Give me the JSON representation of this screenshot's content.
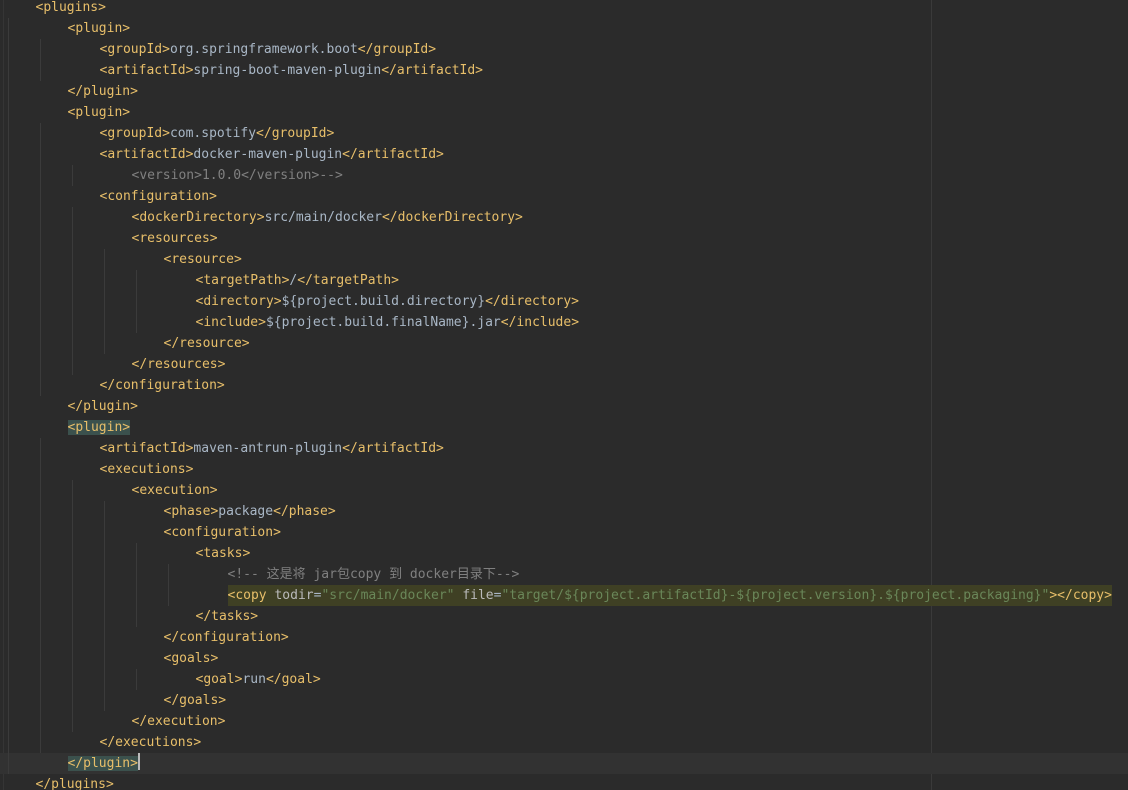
{
  "editor": {
    "file_language": "xml",
    "colors": {
      "background": "#2b2b2b",
      "tag": "#e8bf6a",
      "text": "#a9b7c6",
      "attribute": "#bababa",
      "value": "#6a8759",
      "comment": "#808080",
      "matched_tag_highlight": "#3b514d",
      "selection_highlight": "#3f4024",
      "caret_line": "#323232"
    },
    "lines": [
      {
        "indent": 1,
        "tokens": [
          {
            "k": "tag",
            "t": "<plugins>"
          }
        ]
      },
      {
        "indent": 2,
        "tokens": [
          {
            "k": "tag",
            "t": "<plugin>"
          }
        ]
      },
      {
        "indent": 3,
        "tokens": [
          {
            "k": "tag",
            "t": "<groupId>"
          },
          {
            "k": "text",
            "t": "org.springframework.boot"
          },
          {
            "k": "tag",
            "t": "</groupId>"
          }
        ]
      },
      {
        "indent": 3,
        "tokens": [
          {
            "k": "tag",
            "t": "<artifactId>"
          },
          {
            "k": "text",
            "t": "spring-boot-maven-plugin"
          },
          {
            "k": "tag",
            "t": "</artifactId>"
          }
        ]
      },
      {
        "indent": 2,
        "tokens": [
          {
            "k": "tag",
            "t": "</plugin>"
          }
        ]
      },
      {
        "indent": 2,
        "tokens": [
          {
            "k": "tag",
            "t": "<plugin>"
          }
        ]
      },
      {
        "indent": 3,
        "tokens": [
          {
            "k": "tag",
            "t": "<groupId>"
          },
          {
            "k": "text",
            "t": "com.spotify"
          },
          {
            "k": "tag",
            "t": "</groupId>"
          }
        ]
      },
      {
        "indent": 3,
        "tokens": [
          {
            "k": "tag",
            "t": "<artifactId>"
          },
          {
            "k": "text",
            "t": "docker-maven-plugin"
          },
          {
            "k": "tag",
            "t": "</artifactId>"
          }
        ]
      },
      {
        "indent": 4,
        "tokens": [
          {
            "k": "com",
            "t": "<version>1.0.0</version>-->"
          }
        ]
      },
      {
        "indent": 3,
        "tokens": [
          {
            "k": "tag",
            "t": "<configuration>"
          }
        ]
      },
      {
        "indent": 4,
        "tokens": [
          {
            "k": "tag",
            "t": "<dockerDirectory>"
          },
          {
            "k": "text",
            "t": "src/main/docker"
          },
          {
            "k": "tag",
            "t": "</dockerDirectory>"
          }
        ]
      },
      {
        "indent": 4,
        "tokens": [
          {
            "k": "tag",
            "t": "<resources>"
          }
        ]
      },
      {
        "indent": 5,
        "tokens": [
          {
            "k": "tag",
            "t": "<resource>"
          }
        ]
      },
      {
        "indent": 6,
        "tokens": [
          {
            "k": "tag",
            "t": "<targetPath>"
          },
          {
            "k": "text",
            "t": "/"
          },
          {
            "k": "tag",
            "t": "</targetPath>"
          }
        ]
      },
      {
        "indent": 6,
        "tokens": [
          {
            "k": "tag",
            "t": "<directory>"
          },
          {
            "k": "text",
            "t": "${project.build.directory}"
          },
          {
            "k": "tag",
            "t": "</directory>"
          }
        ]
      },
      {
        "indent": 6,
        "tokens": [
          {
            "k": "tag",
            "t": "<include>"
          },
          {
            "k": "text",
            "t": "${project.build.finalName}.jar"
          },
          {
            "k": "tag",
            "t": "</include>"
          }
        ]
      },
      {
        "indent": 5,
        "tokens": [
          {
            "k": "tag",
            "t": "</resource>"
          }
        ]
      },
      {
        "indent": 4,
        "tokens": [
          {
            "k": "tag",
            "t": "</resources>"
          }
        ]
      },
      {
        "indent": 3,
        "tokens": [
          {
            "k": "tag",
            "t": "</configuration>"
          }
        ]
      },
      {
        "indent": 2,
        "tokens": [
          {
            "k": "tag",
            "t": "</plugin>"
          }
        ]
      },
      {
        "indent": 2,
        "tokens": [
          {
            "k": "tag",
            "t": "<plugin>",
            "hl": "match"
          }
        ]
      },
      {
        "indent": 3,
        "tokens": [
          {
            "k": "tag",
            "t": "<artifactId>"
          },
          {
            "k": "text",
            "t": "maven-antrun-plugin"
          },
          {
            "k": "tag",
            "t": "</artifactId>"
          }
        ]
      },
      {
        "indent": 3,
        "tokens": [
          {
            "k": "tag",
            "t": "<executions>"
          }
        ]
      },
      {
        "indent": 4,
        "tokens": [
          {
            "k": "tag",
            "t": "<execution>"
          }
        ]
      },
      {
        "indent": 5,
        "tokens": [
          {
            "k": "tag",
            "t": "<phase>"
          },
          {
            "k": "text",
            "t": "package"
          },
          {
            "k": "tag",
            "t": "</phase>"
          }
        ]
      },
      {
        "indent": 5,
        "tokens": [
          {
            "k": "tag",
            "t": "<configuration>"
          }
        ]
      },
      {
        "indent": 6,
        "tokens": [
          {
            "k": "tag",
            "t": "<tasks>"
          }
        ]
      },
      {
        "indent": 7,
        "tokens": [
          {
            "k": "com",
            "t": "<!-- 这是将 jar包copy 到 docker目录下-->"
          }
        ]
      },
      {
        "indent": 7,
        "hl_line": true,
        "tokens": [
          {
            "k": "tag",
            "t": "<copy "
          },
          {
            "k": "attr",
            "t": "todir"
          },
          {
            "k": "eq",
            "t": "="
          },
          {
            "k": "val",
            "t": "\"src/main/docker\""
          },
          {
            "k": "ws",
            "t": " "
          },
          {
            "k": "attr",
            "t": "file"
          },
          {
            "k": "eq",
            "t": "="
          },
          {
            "k": "val",
            "t": "\"target/${project.artifactId}-${project.version}.${project.packaging}\""
          },
          {
            "k": "tag",
            "t": "></copy>"
          }
        ]
      },
      {
        "indent": 6,
        "tokens": [
          {
            "k": "tag",
            "t": "</tasks>"
          }
        ]
      },
      {
        "indent": 5,
        "tokens": [
          {
            "k": "tag",
            "t": "</configuration>"
          }
        ]
      },
      {
        "indent": 5,
        "tokens": [
          {
            "k": "tag",
            "t": "<goals>"
          }
        ]
      },
      {
        "indent": 6,
        "tokens": [
          {
            "k": "tag",
            "t": "<goal>"
          },
          {
            "k": "text",
            "t": "run"
          },
          {
            "k": "tag",
            "t": "</goal>"
          }
        ]
      },
      {
        "indent": 5,
        "tokens": [
          {
            "k": "tag",
            "t": "</goals>"
          }
        ]
      },
      {
        "indent": 4,
        "tokens": [
          {
            "k": "tag",
            "t": "</execution>"
          }
        ]
      },
      {
        "indent": 3,
        "tokens": [
          {
            "k": "tag",
            "t": "</executions>"
          }
        ]
      },
      {
        "indent": 2,
        "caret": true,
        "tokens": [
          {
            "k": "tag",
            "t": "</plugin>",
            "hl": "match"
          }
        ]
      },
      {
        "indent": 1,
        "tokens": [
          {
            "k": "tag",
            "t": "</plugins>"
          }
        ]
      }
    ]
  }
}
